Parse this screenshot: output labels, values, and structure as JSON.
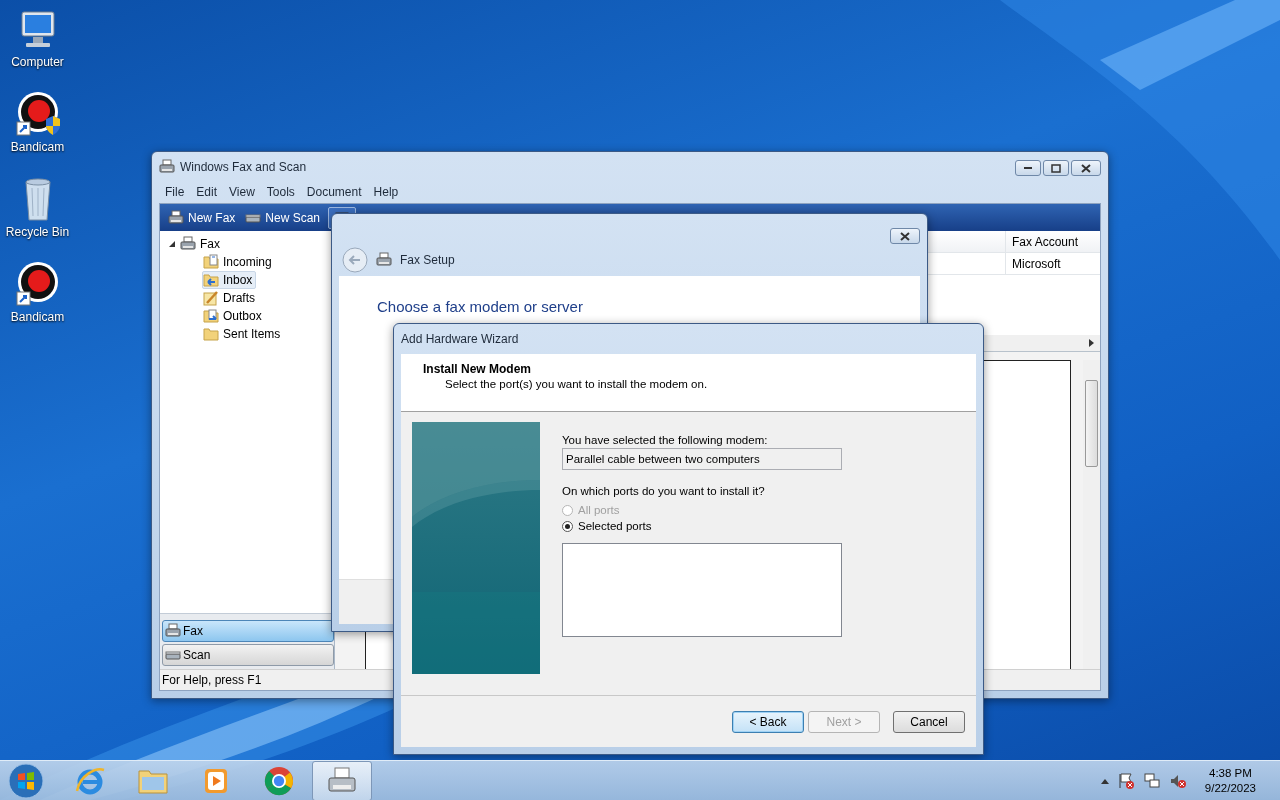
{
  "desktop_icons": [
    {
      "label": "Computer",
      "kind": "computer"
    },
    {
      "label": "Bandicam",
      "kind": "bandicam"
    },
    {
      "label": "Recycle Bin",
      "kind": "recycle"
    },
    {
      "label": "Bandicam",
      "kind": "bandicam2"
    }
  ],
  "main_window": {
    "title": "Windows Fax and Scan",
    "menu": [
      "File",
      "Edit",
      "View",
      "Tools",
      "Document",
      "Help"
    ],
    "toolbar": [
      {
        "label": "New Fax",
        "kind": "fax"
      },
      {
        "label": "New Scan",
        "kind": "scan"
      }
    ],
    "tree": {
      "label": "Fax",
      "expanded": true,
      "children": [
        {
          "label": "Incoming",
          "kind": "incoming",
          "selected": false
        },
        {
          "label": "Inbox",
          "kind": "inbox",
          "selected": true
        },
        {
          "label": "Drafts",
          "kind": "drafts",
          "selected": false
        },
        {
          "label": "Outbox",
          "kind": "outbox",
          "selected": false
        },
        {
          "label": "Sent Items",
          "kind": "sent",
          "selected": false
        }
      ]
    },
    "nav_buttons": [
      {
        "label": "Fax",
        "kind": "fax",
        "selected": true
      },
      {
        "label": "Scan",
        "kind": "scan",
        "selected": false
      }
    ],
    "list": {
      "columns": [
        "Fax Account"
      ],
      "rows": [
        [
          "Microsoft"
        ]
      ]
    },
    "status_bar": "For Help, press F1"
  },
  "fax_setup": {
    "title": "Fax Setup",
    "heading": "Choose a fax modem or server"
  },
  "wizard": {
    "title": "Add Hardware Wizard",
    "header_title": "Install New Modem",
    "header_subtitle": "Select the port(s) you want to install the modem on.",
    "modem_label": "You have selected the following modem:",
    "modem_value": "Parallel cable between two computers",
    "ports_question": "On which ports do you want to install it?",
    "port_options": [
      {
        "label": "All ports",
        "selected": false,
        "disabled": true
      },
      {
        "label": "Selected ports",
        "selected": true,
        "disabled": false
      }
    ],
    "buttons": [
      {
        "label": "< Back",
        "default": true,
        "disabled": false
      },
      {
        "label": "Next >",
        "default": false,
        "disabled": true
      },
      {
        "label": "Cancel",
        "default": false,
        "disabled": false
      }
    ]
  },
  "taskbar": {
    "apps": [
      {
        "kind": "ie",
        "active": false
      },
      {
        "kind": "explorer",
        "active": false
      },
      {
        "kind": "media",
        "active": false
      },
      {
        "kind": "chrome",
        "active": false
      },
      {
        "kind": "fax",
        "active": true
      }
    ],
    "clock": {
      "time": "4:38 PM",
      "date": "9/22/2023"
    }
  }
}
